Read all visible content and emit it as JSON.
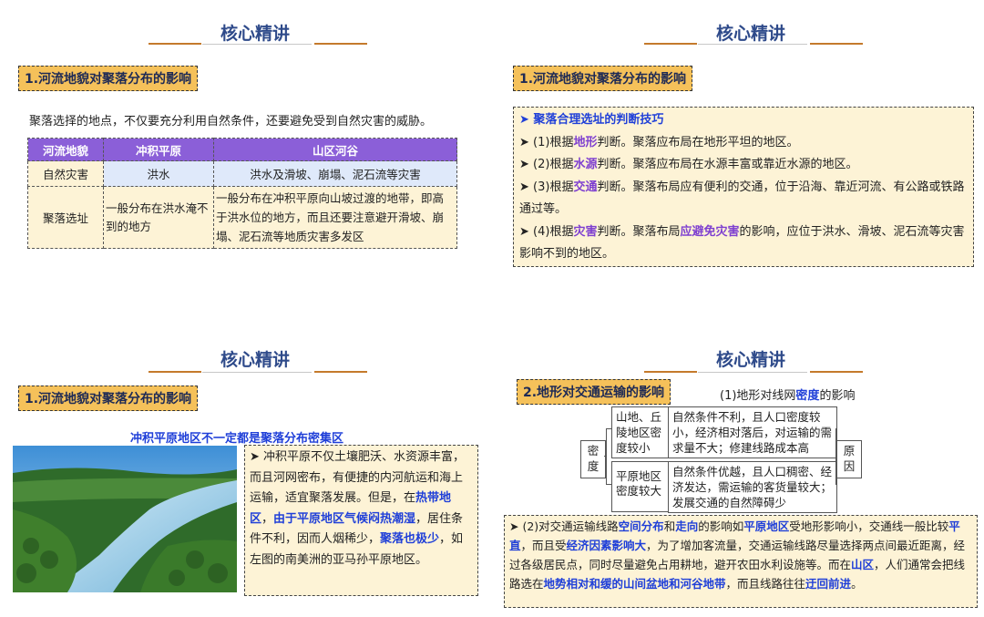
{
  "heading": "核心精讲",
  "panel1": {
    "tag": "1.河流地貌对聚落分布的影响",
    "intro": "聚落选择的地点，不仅要充分利用自然条件，还要避免受到自然灾害的威胁。",
    "table": {
      "headers": [
        "河流地貌",
        "冲积平原",
        "山区河谷"
      ],
      "rows": [
        [
          "自然灾害",
          "洪水",
          "洪水及滑坡、崩塌、泥石流等灾害"
        ],
        [
          "聚落选址",
          "一般分布在洪水淹不到的地方",
          "一般分布在冲积平原向山坡过渡的地带，即高于洪水位的地方，而且还要注意避开滑坡、崩塌、泥石流等地质灾害多发区"
        ]
      ]
    }
  },
  "panel2": {
    "tag": "1.河流地貌对聚落分布的影响",
    "title": "聚落合理选址的判断技巧",
    "items": [
      {
        "pre": "(1)根据",
        "key": "地形",
        "post": "判断。聚落应布局在地形平坦的地区。"
      },
      {
        "pre": "(2)根据",
        "key": "水源",
        "post": "判断。聚落应布局在水源丰富或靠近水源的地区。"
      },
      {
        "pre": "(3)根据",
        "key": "交通",
        "post": "判断。聚落布局应有便利的交通，位于沿海、靠近河流、有公路或铁路通过等。"
      },
      {
        "pre": "(4)根据",
        "key": "灾害",
        "post": "判断。聚落布局",
        "key2": "应避免灾害",
        "post2": "的影响，应位于洪水、滑坡、泥石流等灾害影响不到的地区。"
      }
    ]
  },
  "panel3": {
    "tag": "1.河流地貌对聚落分布的影响",
    "subtitle": "冲积平原地区不一定都是聚落分布密集区",
    "text_a": "冲积平原不仅土壤肥沃、水资源丰富，而且河网密布，有便捷的内河航运和海上运输，适宜聚落发展。但是，在",
    "key_a": "热带地区",
    "text_b": "，",
    "key_b": "由于平原地区气候闷热潮湿",
    "text_c": "，居住条件不利，因而人烟稀少，",
    "key_c": "聚落也极少",
    "text_d": "，如左图的南美洲的亚马孙平原地区。"
  },
  "panel4": {
    "tag": "2.地形对交通运输的影响",
    "caption_pre": "(1)地形对线网",
    "caption_key": "密度",
    "caption_post": "的影响",
    "diagram": {
      "left": "密度",
      "right": "原因",
      "a_label": "山地、丘陵地区密度较小",
      "a_reason": "自然条件不利，且人口密度较小，经济相对落后，对运输的需求量不大；修建线路成本高",
      "b_label": "平原地区密度较大",
      "b_reason": "自然条件优越，且人口稠密、经济发达，需运输的客货量较大；发展交通的自然障碍少"
    },
    "p2": {
      "s1": "(2)对交通运输线路",
      "k1": "空间分布",
      "s2": "和",
      "k2": "走向",
      "s3": "的影响如",
      "k3": "平原地区",
      "s4": "受地形影响小，交通线一般比较",
      "k4": "平直",
      "s5": "，而且受",
      "k5": "经济因素影响大",
      "s6": "，为了增加客流量，交通运输线路尽量选择两点间最近距离，经过各级居民点，同时尽量避免占用耕地，避开农田水利设施等。而在",
      "k6": "山区",
      "s7": "，人们通常会把线路选在",
      "k7": "地势相对和缓的山间盆地和河谷地带",
      "s8": "，而且线路往往",
      "k8": "迂回前进",
      "s9": "。"
    }
  },
  "colors": {
    "accent": "#c47a2c",
    "tag_bg": "#f5c15a",
    "note_bg": "#fdf3d6",
    "table_head": "#8b5fd8",
    "key_blue": "#1f3fd8",
    "key_purple": "#7e3fd0"
  }
}
